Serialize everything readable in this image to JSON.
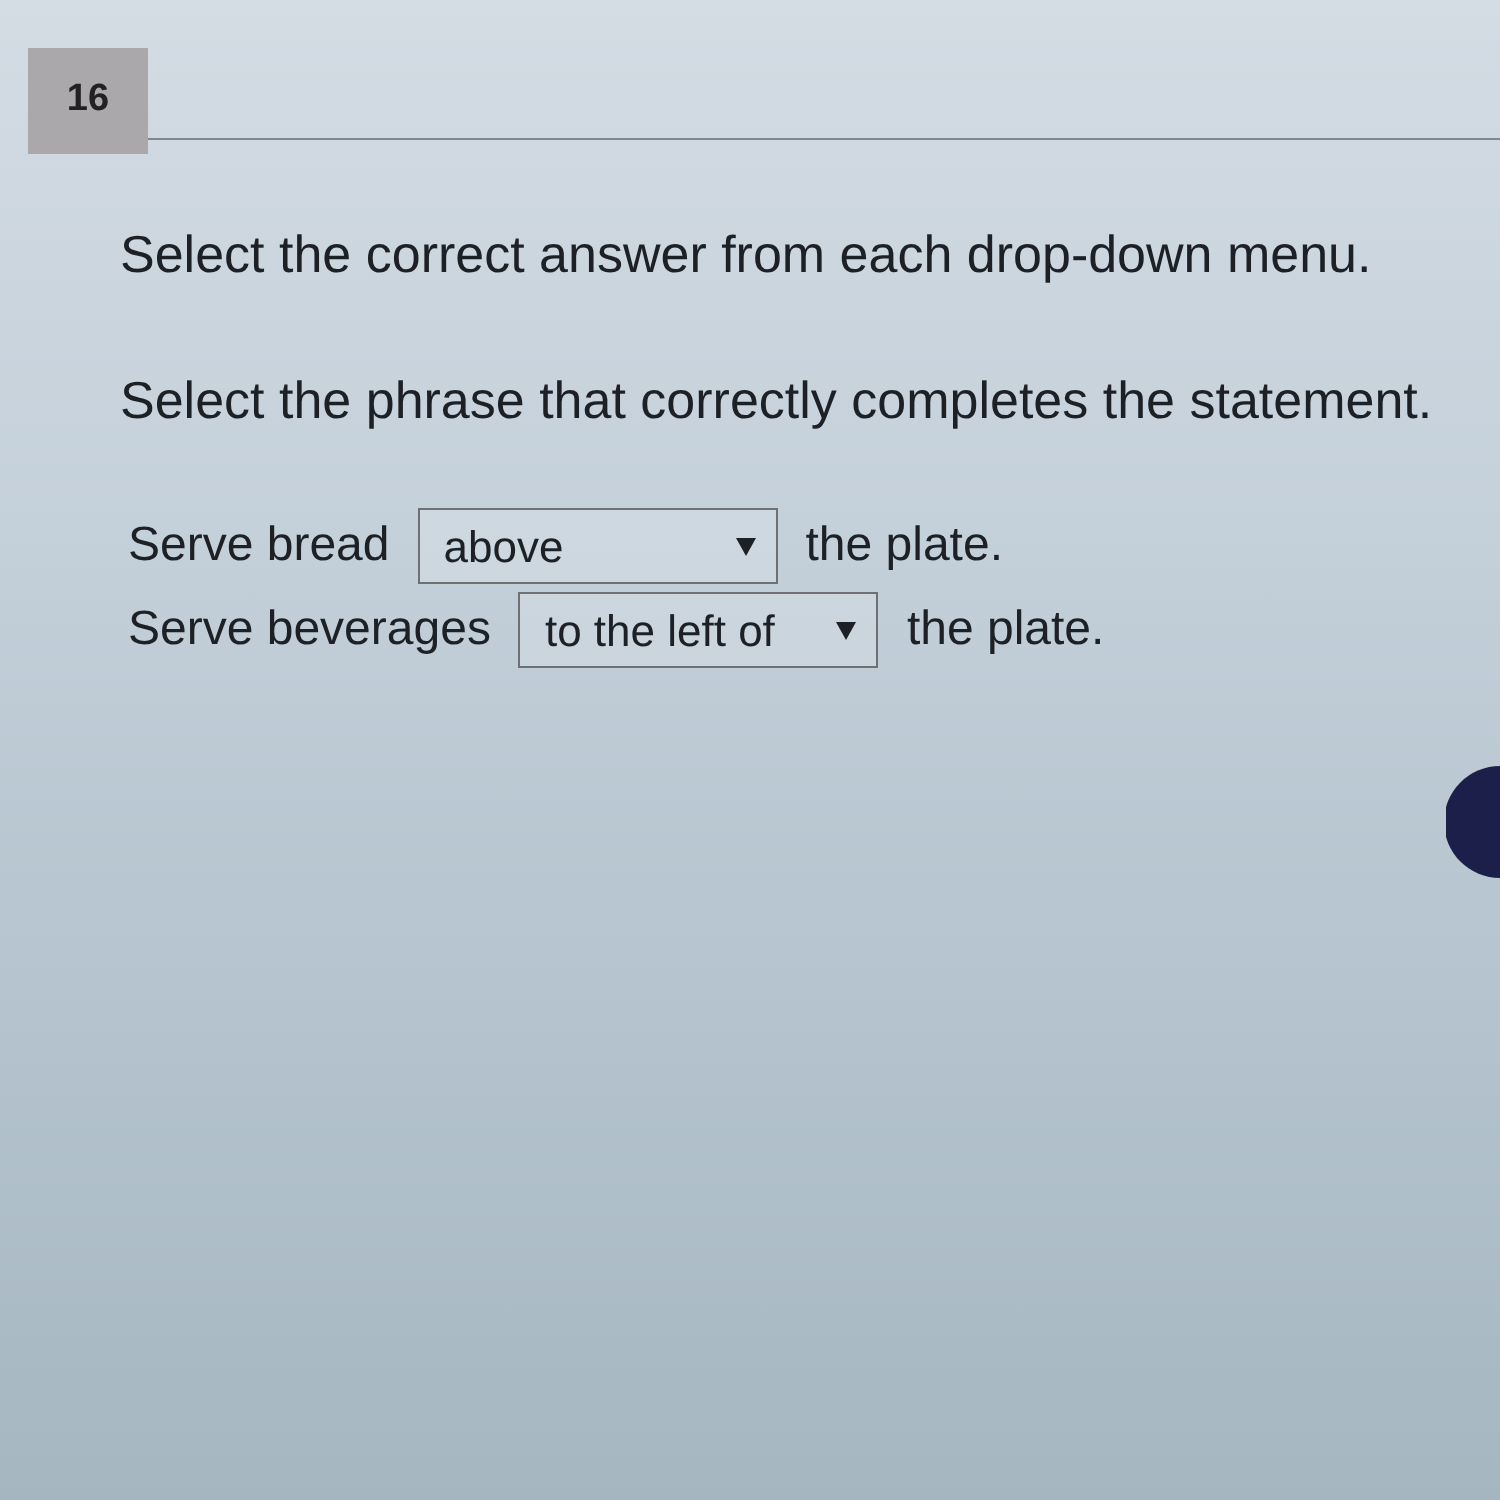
{
  "question_number": "16",
  "instructions": [
    "Select the correct answer from each drop-down menu.",
    "Select the phrase that correctly completes the statement."
  ],
  "statements": [
    {
      "before": "Serve bread",
      "dropdown": {
        "value": "above"
      },
      "after": "the plate."
    },
    {
      "before": "Serve beverages",
      "dropdown": {
        "value": "to the left of"
      },
      "after": "the plate."
    }
  ]
}
